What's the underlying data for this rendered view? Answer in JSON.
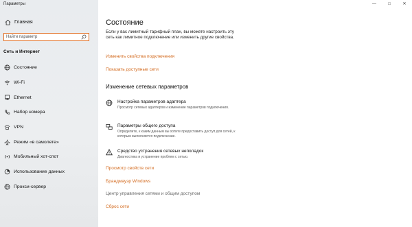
{
  "window": {
    "title": "Параметры",
    "buttons": [
      "—",
      "□",
      "✕"
    ]
  },
  "sidebar": {
    "home_label": "Главная",
    "search_placeholder": "Найти параметр",
    "section_label": "Сеть и Интернет",
    "items": [
      {
        "label": "Состояние",
        "icon": "globe-icon"
      },
      {
        "label": "Wi-Fi",
        "icon": "wifi-icon"
      },
      {
        "label": "Ethernet",
        "icon": "ethernet-icon"
      },
      {
        "label": "Набор номера",
        "icon": "dialup-phone-icon"
      },
      {
        "label": "VPN",
        "icon": "vpn-icon"
      },
      {
        "label": "Режим «в самолете»",
        "icon": "airplane-icon"
      },
      {
        "label": "Мобильный хот-спот",
        "icon": "hotspot-icon"
      },
      {
        "label": "Использование данных",
        "icon": "data-usage-icon"
      },
      {
        "label": "Прокси-сервер",
        "icon": "proxy-globe-icon"
      }
    ]
  },
  "main": {
    "title": "Состояние",
    "description": "Если у вас лимитный тарифный план, вы можете настроить эту сеть как лимитное подключение или изменить другие свойства.",
    "link_change_props": "Изменить свойства подключения",
    "link_show_networks": "Показать доступные сети",
    "section_title": "Изменение сетевых параметров",
    "options": [
      {
        "title": "Настройка параметров адаптера",
        "desc": "Просмотр сетевых адаптеров и изменение параметров подключения.",
        "icon": "adapter-icon"
      },
      {
        "title": "Параметры общего доступа",
        "desc": "Определите, к каким данным вы хотите предоставить доступ для сетей, к которым выполняется подключение.",
        "icon": "sharing-icon"
      },
      {
        "title": "Средство устранения сетевых неполадок",
        "desc": "Диагностика и устранение проблем с сетью.",
        "icon": "warning-icon"
      }
    ],
    "links": [
      {
        "label": "Просмотр свойств сети",
        "style": "accent"
      },
      {
        "label": "Брандмауэр Windows",
        "style": "accent"
      },
      {
        "label": "Центр управления сетями и общим доступом",
        "style": "gray"
      },
      {
        "label": "Сброс сети",
        "style": "accent"
      }
    ]
  },
  "colors": {
    "accent": "#d36a1e",
    "search_border": "#e06a1c"
  }
}
